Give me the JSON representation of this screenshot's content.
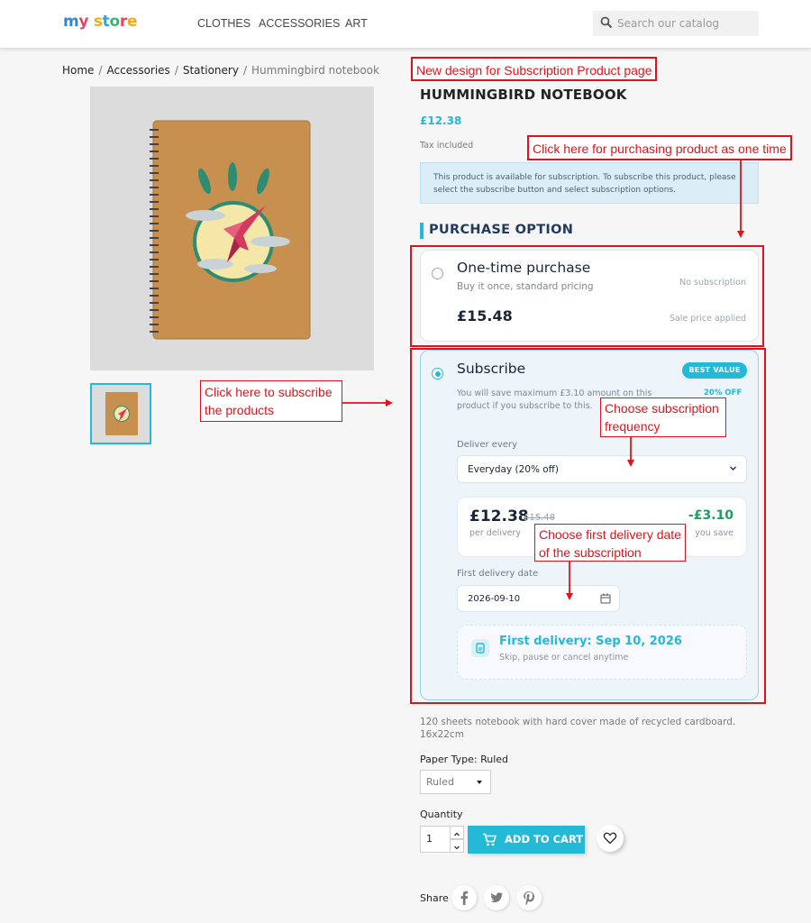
{
  "header": {
    "logo": [
      "m",
      "y",
      " ",
      "s",
      "t",
      "o",
      "r",
      "e"
    ],
    "logo_colors": [
      "#2c8ad6",
      "#e84360",
      "#ffffff",
      "#f6a81b",
      "#2aa7d6",
      "#34b57a",
      "#e84360",
      "#f6a81b"
    ],
    "nav": [
      "CLOTHES",
      "ACCESSORIES",
      "ART"
    ],
    "search_placeholder": "Search our catalog"
  },
  "breadcrumb": [
    "Home",
    "Accessories",
    "Stationery",
    "Hummingbird notebook"
  ],
  "product": {
    "title": "HUMMINGBIRD NOTEBOOK",
    "price": "£12.38",
    "tax": "Tax included",
    "info": "This product is available for subscription. To subscribe this product, please select the subscribe button and select subscription options.",
    "purchase_option_title": "PURCHASE OPTION",
    "one_time": {
      "title": "One-time purchase",
      "subtitle": "Buy it once, standard pricing",
      "note": "No subscription",
      "price": "£15.48",
      "sale_note": "Sale price applied"
    },
    "subscribe": {
      "title": "Subscribe",
      "badge": "BEST VALUE",
      "off": "20% OFF",
      "save_text": "You will save maximum £3.10 amount on this product if you subscribe to this.",
      "deliver_label": "Deliver every",
      "frequency": "Everyday (20% off)",
      "price": "£12.38",
      "old_price": "£15.48",
      "per_delivery": "per delivery",
      "saving": "-£3.10",
      "you_save": "you save",
      "first_delivery_label": "First delivery date",
      "first_delivery_date": "2026-09-10",
      "first_delivery_title": "First delivery: Sep 10, 2026",
      "first_delivery_sub": "Skip, pause or cancel anytime"
    },
    "description": "120 sheets notebook with hard cover made of recycled cardboard. 16x22cm",
    "paper_type_label": "Paper Type: Ruled",
    "paper_type_value": "Ruled",
    "quantity_label": "Quantity",
    "quantity_value": "1",
    "add_to_cart": "ADD TO CART",
    "share_label": "Share"
  },
  "annotations": {
    "design": "New design for Subscription Product page",
    "one_time_note": "Click here for purchasing product as one time",
    "subscribe_note": "Click here to subscribe the products",
    "frequency_note": "Choose subscription frequency",
    "date_note": "Choose first delivery date of the subscription"
  },
  "colors": {
    "accent": "#24b9d7",
    "saving_green": "#1e9e63",
    "annotation_red": "#e0131b"
  },
  "icons": [
    "search-icon",
    "chevron-down-icon",
    "calendar-icon",
    "box-icon",
    "cart-icon",
    "heart-icon",
    "facebook-icon",
    "twitter-icon",
    "pinterest-icon"
  ]
}
